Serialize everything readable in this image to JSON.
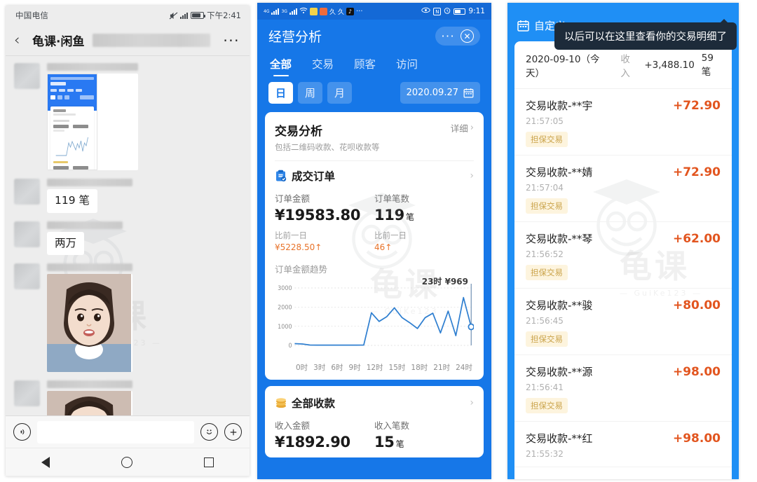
{
  "panel1": {
    "status": {
      "carrier": "中国电信",
      "time": "下午2:41"
    },
    "navbar": {
      "back_icon": "chevron-left-icon",
      "title": "龟课·闲鱼",
      "more_icon": "more-horizontal-icon"
    },
    "messages": [
      {
        "type": "image-screenshot",
        "alt": "经营分析截图"
      },
      {
        "type": "text",
        "text": "119 笔"
      },
      {
        "type": "text",
        "text": "两万"
      },
      {
        "type": "image-photo",
        "alt": "儿童照片"
      },
      {
        "type": "image-photo",
        "alt": "儿童照片"
      }
    ],
    "inputbar": {
      "voice_icon": "voice-icon",
      "input_placeholder": "",
      "emoji_icon": "emoji-icon",
      "plus_icon": "plus-icon"
    },
    "navbuttons": {
      "back": "back-triangle",
      "home": "home-circle",
      "recents": "recents-square"
    }
  },
  "panel2": {
    "status": {
      "time": "9:11"
    },
    "header": {
      "title": "经营分析",
      "more_icon": "more-horizontal-icon",
      "close_icon": "close-icon"
    },
    "tabs": [
      {
        "label": "全部",
        "active": true
      },
      {
        "label": "交易",
        "active": false
      },
      {
        "label": "顾客",
        "active": false
      },
      {
        "label": "访问",
        "active": false
      }
    ],
    "segments": [
      {
        "label": "日",
        "active": true
      },
      {
        "label": "周",
        "active": false
      },
      {
        "label": "月",
        "active": false
      }
    ],
    "date": {
      "value": "2020.09.27",
      "icon": "calendar-icon"
    },
    "trade_card": {
      "title": "交易分析",
      "subtitle": "包括二维码收款、花呗收款等",
      "detail_link": "详细",
      "order_section": {
        "icon": "clipboard-check-icon",
        "title": "成交订单",
        "metrics": [
          {
            "label": "订单金额",
            "value": "¥19583.80",
            "unit": "",
            "compare_label": "比前一日",
            "compare_value": "¥5228.50",
            "compare_dir": "↑"
          },
          {
            "label": "订单笔数",
            "value": "119",
            "unit": "笔",
            "compare_label": "比前一日",
            "compare_value": "46",
            "compare_dir": "↑"
          }
        ]
      },
      "trend_label": "订单金额趋势",
      "chart_note": "23时 ¥969"
    },
    "income_card": {
      "icon": "coins-icon",
      "title": "全部收款",
      "metrics": [
        {
          "label": "收入金额",
          "value": "¥1892.90",
          "unit": ""
        },
        {
          "label": "收入笔数",
          "value": "15",
          "unit": "笔"
        }
      ]
    }
  },
  "panel3": {
    "header": {
      "calendar_icon": "calendar-icon",
      "custom_label": "自定义"
    },
    "tooltip": {
      "text": "以后可以在这里查看你的交易明细了"
    },
    "summary": {
      "date": "2020-09-10（今天）",
      "income_label": "收入",
      "income_amount": "+3,488.10",
      "count": "59笔"
    },
    "transactions": [
      {
        "title": "交易收款-**宇",
        "time": "21:57:05",
        "amount": "+72.90",
        "tag": "担保交易"
      },
      {
        "title": "交易收款-**婧",
        "time": "21:57:04",
        "amount": "+72.90",
        "tag": "担保交易"
      },
      {
        "title": "交易收款-**琴",
        "time": "21:56:52",
        "amount": "+62.00",
        "tag": "担保交易"
      },
      {
        "title": "交易收款-**骏",
        "time": "21:56:45",
        "amount": "+80.00",
        "tag": "担保交易"
      },
      {
        "title": "交易收款-**源",
        "time": "21:56:41",
        "amount": "+98.00",
        "tag": "担保交易"
      },
      {
        "title": "交易收款-**红",
        "time": "21:55:32",
        "amount": "+98.00",
        "tag": ""
      }
    ]
  },
  "watermark": {
    "text": "龟课",
    "sub": "— GuiKe123 —"
  },
  "colors": {
    "wechat_bg": "#ededed",
    "alipay_blue": "#1677e8",
    "alipay_blue_light": "#1f8ff5",
    "amount_orange": "#e2551f",
    "compare_orange": "#e8732a",
    "tag_bg": "#fdf4de",
    "tag_text": "#caa34a",
    "chart_line": "#2f7fd0"
  },
  "chart_data": {
    "type": "line",
    "title": "订单金额趋势",
    "xlabel": "",
    "ylabel": "",
    "ylim": [
      0,
      3000
    ],
    "yticks": [
      0,
      1000,
      2000,
      3000
    ],
    "xticks": [
      "0时",
      "3时",
      "6时",
      "9时",
      "12时",
      "15时",
      "18时",
      "21时",
      "24时"
    ],
    "grid": true,
    "annotation": {
      "text": "23时 ¥969",
      "x": 23,
      "y": 969
    },
    "marker": {
      "x": 23,
      "y": 969
    },
    "x": [
      0,
      1,
      2,
      3,
      4,
      5,
      6,
      7,
      8,
      9,
      10,
      11,
      12,
      13,
      14,
      15,
      16,
      17,
      18,
      19,
      20,
      21,
      22,
      23
    ],
    "values": [
      90,
      75,
      20,
      15,
      15,
      15,
      15,
      15,
      15,
      20,
      1700,
      1250,
      1500,
      1960,
      1450,
      1180,
      880,
      1450,
      1680,
      650,
      1790,
      510,
      2500,
      969
    ]
  }
}
